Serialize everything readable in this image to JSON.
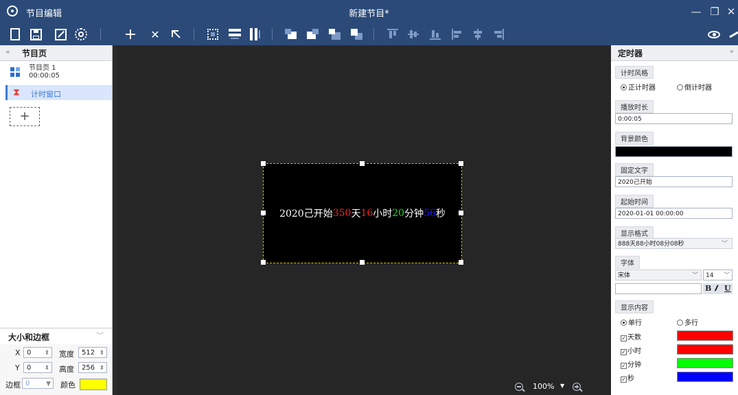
{
  "window": {
    "app_title": "节目编辑",
    "doc_title": "新建节目*",
    "min_glyph": "—",
    "restore_glyph": "❐",
    "close_glyph": "✕"
  },
  "toolbar": {
    "icons": [
      "new-file-icon",
      "save-icon",
      "resize-icon",
      "settings-icon",
      "add-icon",
      "delete-icon",
      "select-icon",
      "fullscreen-icon",
      "fit-width-icon",
      "fit-height-icon",
      "layer-bottom-icon",
      "layer-back-icon",
      "layer-front-icon",
      "layer-top-icon",
      "align-top-icon",
      "align-vcenter-icon",
      "align-bottom-icon",
      "align-left-icon",
      "align-hcenter-icon",
      "align-right-icon",
      "preview-icon",
      "send-icon"
    ],
    "add_glyph": "+",
    "delete_glyph": "✕"
  },
  "left_panel": {
    "collapse_glyph": "«",
    "title": "节目页",
    "pages": [
      {
        "name": "节目页 1",
        "duration": "00:00:05"
      }
    ],
    "window_item": "计时窗口",
    "hourglass_glyph": "⧗",
    "add_glyph": "+",
    "size_section": {
      "title": "大小和边框",
      "chevron": "﹀",
      "x_label": "X",
      "x_value": "0",
      "width_label": "宽度",
      "width_value": "512",
      "y_label": "Y",
      "y_value": "0",
      "height_label": "高度",
      "height_value": "256",
      "border_label": "边框",
      "border_value": "0",
      "color_label": "颜色",
      "color": "#ffff00",
      "spin_glyph": "⬍",
      "dd_glyph": "▼"
    }
  },
  "canvas": {
    "timer_text": {
      "prefix": "2020己开始",
      "days": "350",
      "days_unit": "天",
      "hours": "16",
      "hours_unit": "小时",
      "minutes": "20",
      "minutes_unit": "分钟",
      "seconds": "56",
      "seconds_unit": "秒"
    },
    "colors": {
      "text": "#ffffff",
      "days": "#ff0000",
      "hours": "#ff0000",
      "minutes": "#00ff00",
      "seconds": "#0000ff"
    },
    "zoom": "100%",
    "zoom_dd": "▼"
  },
  "right_panel": {
    "title": "定时器",
    "collapse_glyph": "»",
    "timer_style": {
      "label": "计时风格",
      "option1": "正计时器",
      "option2": "倒计时器"
    },
    "duration": {
      "label": "播放时长",
      "value": "0:00:05"
    },
    "bg_color": {
      "label": "背景颜色",
      "color": "#000000"
    },
    "fixed_text": {
      "label": "固定文字",
      "value": "2020己开始"
    },
    "start_time": {
      "label": "起始时间",
      "value": "2020-01-01 00:00:00"
    },
    "display_format": {
      "label": "显示格式",
      "value": "888天88小时08分08秒",
      "dd": "﹀"
    },
    "font": {
      "label": "字体",
      "family": "宋体",
      "size": "14",
      "dd": "﹀",
      "bold": "B",
      "italic": "𝑰",
      "underline": "U"
    },
    "display_content": {
      "label": "显示内容",
      "single": "单行",
      "multi": "多行",
      "check": "✓",
      "items": [
        {
          "label": "天数",
          "color": "#ff0000"
        },
        {
          "label": "小时",
          "color": "#ff0000"
        },
        {
          "label": "分钟",
          "color": "#00ff00"
        },
        {
          "label": "秒",
          "color": "#0000ff"
        }
      ]
    }
  }
}
